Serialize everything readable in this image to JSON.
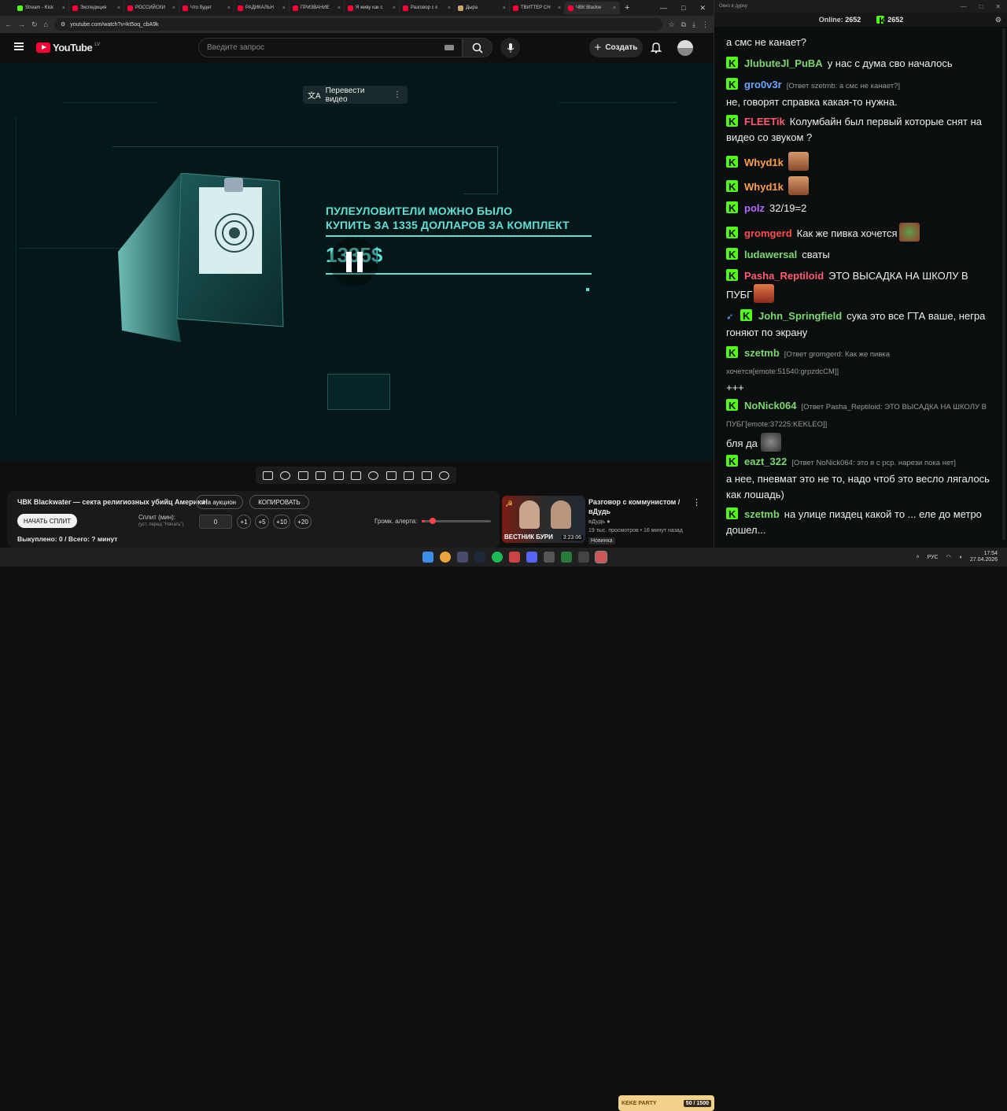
{
  "browser": {
    "tabs": [
      {
        "label": "Stream - Kick",
        "color": "#53fc18"
      },
      {
        "label": "Экспедиция",
        "color": "#ff0033"
      },
      {
        "label": "РОССИЙСКИ",
        "color": "#ff0033"
      },
      {
        "label": "Что будет",
        "color": "#ff0033"
      },
      {
        "label": "РАДИКАЛЬН",
        "color": "#ff0033"
      },
      {
        "label": "ПРИЗВАНИЕ",
        "color": "#ff0033"
      },
      {
        "label": "Я живу как с",
        "color": "#ff0033"
      },
      {
        "label": "Разговор с к",
        "color": "#ff0033"
      },
      {
        "label": "Дыра",
        "color": "#caa56a"
      },
      {
        "label": "ТВИТТЕР СН",
        "color": "#ff0033"
      },
      {
        "label": "ЧВК Blackw",
        "color": "#ff0033"
      }
    ],
    "new_tab": "+",
    "url": "youtube.com/watch?v=kt5oq_cbA9k"
  },
  "youtube": {
    "logo": "YouTube",
    "region": "LV",
    "search_placeholder": "Введите запрос",
    "create_label": "Создать",
    "translate_label": "Перевести видео"
  },
  "video": {
    "headline_line1": "ПУЛЕУЛОВИТЕЛИ МОЖНО БЫЛО",
    "headline_line2": "КУПИТЬ ЗА 1335 ДОЛЛАРОВ ЗА КОМПЛЕКТ",
    "price": "1335$",
    "accent": "#5fe0d6"
  },
  "below": {
    "title": "ЧВК Blackwater — секта религиозных убийц Америки!",
    "auction_button": "На аукцион",
    "copy_button": "КОПИРОВАТЬ",
    "start_split_button": "НАЧАТЬ СПЛИТ",
    "split_label": "Сплит (мин):",
    "split_hint": "(уст. перед \"Начать\")",
    "split_value": "0",
    "plus_buttons": [
      "+1",
      "+5",
      "+10",
      "+20"
    ],
    "volume_label": "Громк. алерта:",
    "volume_level": 0.05,
    "bought": "Выкуплено: 0 / Всего: ? минут"
  },
  "recommended": {
    "title": "Разговор с коммунистом / вДудь",
    "channel": "вДудь",
    "meta": "19 тыс. просмотров • 16 минут назад",
    "badge": "Новинка",
    "duration": "3:23:06",
    "thumb_text": "ВЕСТНИК БУРИ"
  },
  "chat": {
    "window_title": "Окно в дурку",
    "online_label": "Online:",
    "online_count": "2652",
    "viewer_count": "2652",
    "messages": [
      {
        "user": "",
        "reply": "",
        "text": "а смс не канает?"
      },
      {
        "user": "JlubuteJl_PuBA",
        "color": "#7cd86e",
        "reply": "",
        "text": "у нас с дума сво началось"
      },
      {
        "user": "gro0v3r",
        "color": "#6aa7ff",
        "reply": "[Ответ szetmb: а смс не канает?]",
        "text": "не, говорят справка какая-то нужна."
      },
      {
        "user": "FLEETik",
        "color": "#ff5a6e",
        "reply": "",
        "text": "Колумбайн был первый которые снят на видео со звуком ?"
      },
      {
        "user": "Whyd1k",
        "color": "#ffa04a",
        "reply": "",
        "text": ""
      },
      {
        "user": "Whyd1k",
        "color": "#ffa04a",
        "reply": "",
        "text": ""
      },
      {
        "user": "polz",
        "color": "#b46cff",
        "reply": "",
        "text": "32/19=2"
      },
      {
        "user": "gromgerd",
        "color": "#ff4d4d",
        "reply": "",
        "text": "Как же пивка хочется"
      },
      {
        "user": "ludawersal",
        "color": "#7cd86e",
        "reply": "",
        "text": "сваты"
      },
      {
        "user": "Pasha_Reptiloid",
        "color": "#ff5a6e",
        "reply": "",
        "text": "ЭТО ВЫСАДКА НА ШКОЛУ В ПУБГ"
      },
      {
        "user": "John_Springfield",
        "color": "#7cd86e",
        "reply": "",
        "text": "сука это все ГТА ваше, негра гоняют по экрану"
      },
      {
        "user": "szetmb",
        "color": "#7cd86e",
        "reply": "[Ответ gromgerd: Как же пивка хочется[emote:51540:grpzdcCM]]",
        "text": "+++"
      },
      {
        "user": "NoNick064",
        "color": "#7cd86e",
        "reply": "[Ответ Pasha_Reptiloid: ЭТО ВЫСАДКА НА ШКОЛУ В ПУБГ[emote:37225:KEKLEO]]",
        "text": "бля да"
      },
      {
        "user": "eazt_322",
        "color": "#7cd86e",
        "reply": "[Ответ NoNick064: это я с рср. нарези пока нет]",
        "text": "а нее, пневмат это не то, надо чтоб это весло лягалось как лошадь)"
      },
      {
        "user": "szetmb",
        "color": "#7cd86e",
        "reply": "",
        "text": "на улице пиздец какой то ... еле до метро дошел..."
      }
    ]
  },
  "taskbar": {
    "widget": "KEKE PARTY",
    "widget_count": "50 / 1500",
    "lang": "РУС",
    "time": "17:54",
    "date": "27.04.2026"
  }
}
